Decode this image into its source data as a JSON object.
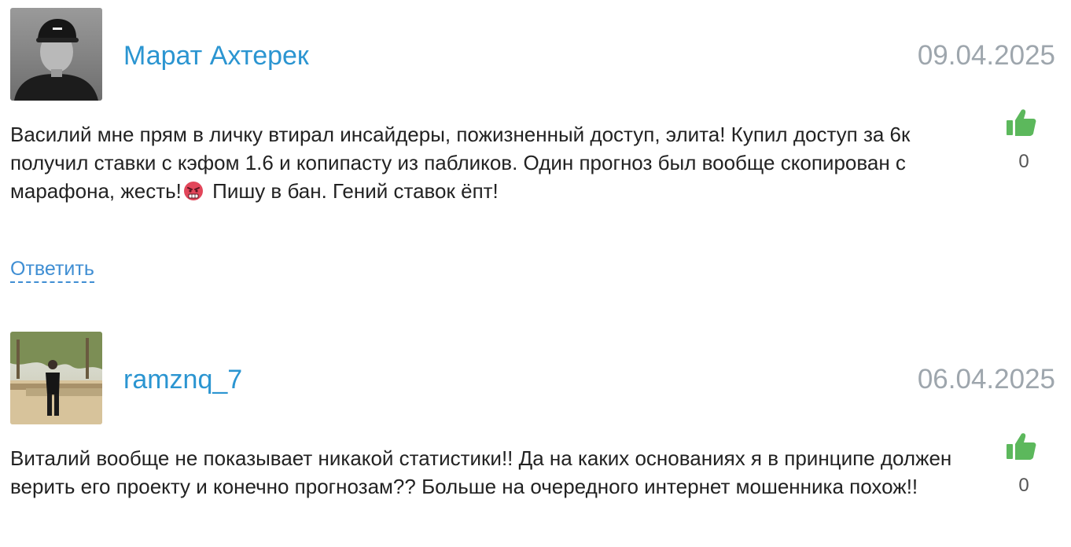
{
  "comments": [
    {
      "author": "Марат Ахтерек",
      "date": "09.04.2025",
      "text_before_emoji": "Василий мне прям в личку втирал инсайдеры, пожизненный доступ, элита! Купил доступ за 6к получил ставки с кэфом 1.6 и копипасту из пабликов. Один прогноз был вообще скопирован с марафона, жесть!",
      "emoji": "angry-face-icon",
      "text_after_emoji": "Пишу в бан. Гений ставок ёпт!",
      "likes": "0",
      "reply_label": "Ответить"
    },
    {
      "author": "ramznq_7",
      "date": "06.04.2025",
      "text": "Виталий вообще не показывает никакой статистики!! Да на каких основаниях я в принципе должен верить его проекту и конечно прогнозам?? Больше на очередного интернет мошенника похож!!",
      "likes": "0"
    }
  ],
  "colors": {
    "author": "#2b95d1",
    "date": "#9ea6ad",
    "like": "#5cb85c",
    "reply": "#3f8ed3",
    "text": "#222222"
  }
}
